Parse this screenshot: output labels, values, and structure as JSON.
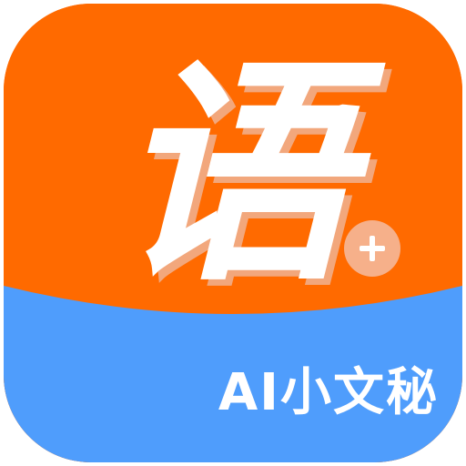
{
  "icon": {
    "main_character": "语",
    "badge_symbol": "plus-icon",
    "product_name": "AI小文秘"
  },
  "colors": {
    "top_orange": "#ff6a00",
    "bottom_blue": "#4f9dfc",
    "glyph_white": "#ffffff",
    "glyph_shadow": "#f2a77c",
    "badge_fill": "#f6b08a",
    "badge_plus": "#ffffff"
  }
}
